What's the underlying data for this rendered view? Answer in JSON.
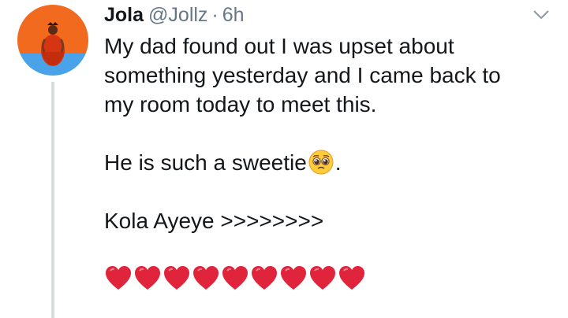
{
  "tweet": {
    "display_name": "Jola",
    "handle": "@Jollz",
    "separator": "·",
    "time": "6h",
    "lines": [
      "My dad found out I was upset about",
      "something yesterday and I came back to",
      "my room today to meet this."
    ],
    "sweetie_text": "He is such a sweetie",
    "sweetie_suffix": ".",
    "kola_line": "Kola Ayeye >>>>>>>>",
    "emoji": {
      "pleading": "pleading-face-icon",
      "heart": "red-heart-icon",
      "heart_count": 9
    },
    "menu_icon": "chevron-down-icon"
  },
  "colors": {
    "text": "#14171a",
    "secondary": "#657786",
    "heart": "#e0243b",
    "thread_line": "#d8dde1",
    "avatar_bg_top": "#f26a1e",
    "avatar_bg_bottom": "#4aa3e8"
  }
}
